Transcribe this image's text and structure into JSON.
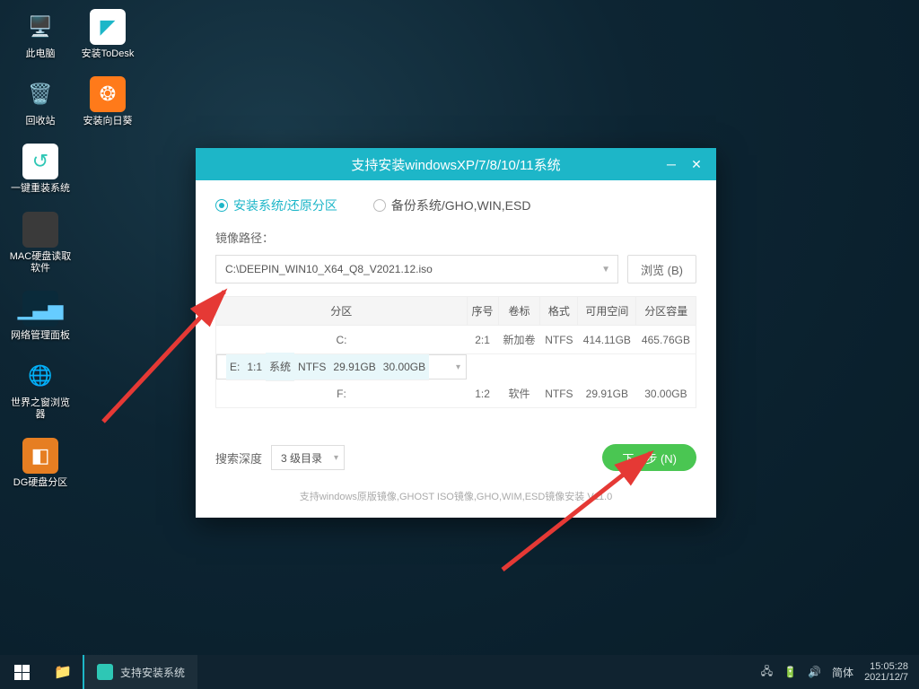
{
  "desktop": {
    "col1": [
      {
        "label": "此电脑",
        "emoji": "🖥️",
        "bg": "transparent"
      },
      {
        "label": "回收站",
        "emoji": "🗑️",
        "bg": "transparent"
      },
      {
        "label": "一键重装系统",
        "emoji": "🟩",
        "bg": "#fff"
      },
      {
        "label": "MAC硬盘读取软件",
        "emoji": "",
        "bg": "#3a3a3a"
      },
      {
        "label": "网络管理面板",
        "emoji": "📶",
        "bg": "#0a2a3a"
      },
      {
        "label": "世界之窗浏览器",
        "emoji": "🌐",
        "bg": "transparent"
      },
      {
        "label": "DG硬盘分区",
        "emoji": "🔲",
        "bg": "#e67e22"
      }
    ],
    "col2": [
      {
        "label": "安装ToDesk",
        "emoji": "◤",
        "bg": "#fff",
        "color": "#1db6c8"
      },
      {
        "label": "安装向日葵",
        "emoji": "❂",
        "bg": "#ff7a1a",
        "color": "#fff"
      }
    ]
  },
  "dialog": {
    "title": "支持安装windowsXP/7/8/10/11系统",
    "radio_install": "安装系统/还原分区",
    "radio_backup": "备份系统/GHO,WIN,ESD",
    "image_path_label": "镜像路径：",
    "image_path_value": "C:\\DEEPIN_WIN10_X64_Q8_V2021.12.iso",
    "browse": "浏览 (B)",
    "cols": {
      "part": "分区",
      "idx": "序号",
      "vol": "卷标",
      "fs": "格式",
      "free": "可用空间",
      "cap": "分区容量"
    },
    "rows": [
      {
        "part": "C:",
        "idx": "2:1",
        "vol": "新加卷",
        "fs": "NTFS",
        "free": "414.11GB",
        "cap": "465.76GB",
        "sel": false
      },
      {
        "part": "E:",
        "idx": "1:1",
        "vol": "系统",
        "fs": "NTFS",
        "free": "29.91GB",
        "cap": "30.00GB",
        "sel": true
      },
      {
        "part": "F:",
        "idx": "1:2",
        "vol": "软件",
        "fs": "NTFS",
        "free": "29.91GB",
        "cap": "30.00GB",
        "sel": false
      }
    ],
    "search_depth_label": "搜索深度",
    "search_depth_value": "3 级目录",
    "next": "下一步 (N)",
    "footer": "支持windows原版镜像,GHOST ISO镜像,GHO,WIM,ESD镜像安装 V11.0"
  },
  "taskbar": {
    "app": "支持安装系统",
    "ime": "简体",
    "time": "15:05:28",
    "date": "2021/12/7"
  }
}
